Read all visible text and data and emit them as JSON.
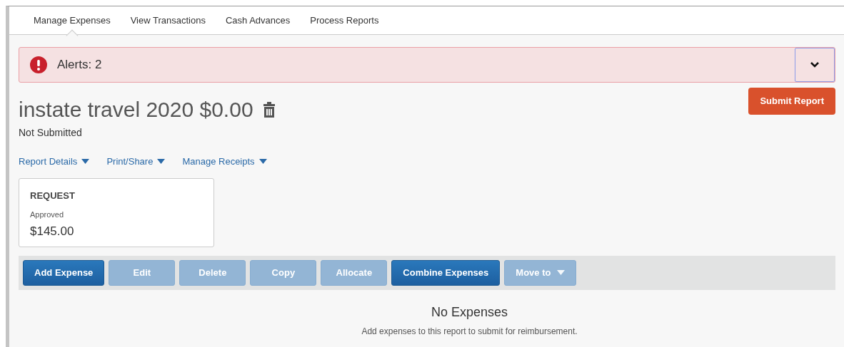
{
  "tabs": [
    {
      "label": "Manage Expenses",
      "selected": true
    },
    {
      "label": "View Transactions",
      "selected": false
    },
    {
      "label": "Cash Advances",
      "selected": false
    },
    {
      "label": "Process Reports",
      "selected": false
    }
  ],
  "alert": {
    "label": "Alerts: 2",
    "expanded": false
  },
  "report": {
    "title": "instate travel 2020 $0.00",
    "status": "Not Submitted",
    "submit_button": "Submit Report"
  },
  "menus": [
    "Report Details",
    "Print/Share",
    "Manage Receipts"
  ],
  "request_card": {
    "heading": "REQUEST",
    "status": "Approved",
    "amount": "$145.00"
  },
  "toolbar": [
    {
      "label": "Add Expense",
      "disabled": false,
      "kind": "button"
    },
    {
      "label": "Edit",
      "disabled": true,
      "kind": "button"
    },
    {
      "label": "Delete",
      "disabled": true,
      "kind": "button"
    },
    {
      "label": "Copy",
      "disabled": true,
      "kind": "button"
    },
    {
      "label": "Allocate",
      "disabled": true,
      "kind": "button"
    },
    {
      "label": "Combine Expenses",
      "disabled": false,
      "kind": "button"
    },
    {
      "label": "Move to",
      "disabled": true,
      "kind": "dropdown"
    }
  ],
  "empty_state": {
    "title": "No Expenses",
    "message": "Add expenses to this report to submit for reimbursement."
  }
}
